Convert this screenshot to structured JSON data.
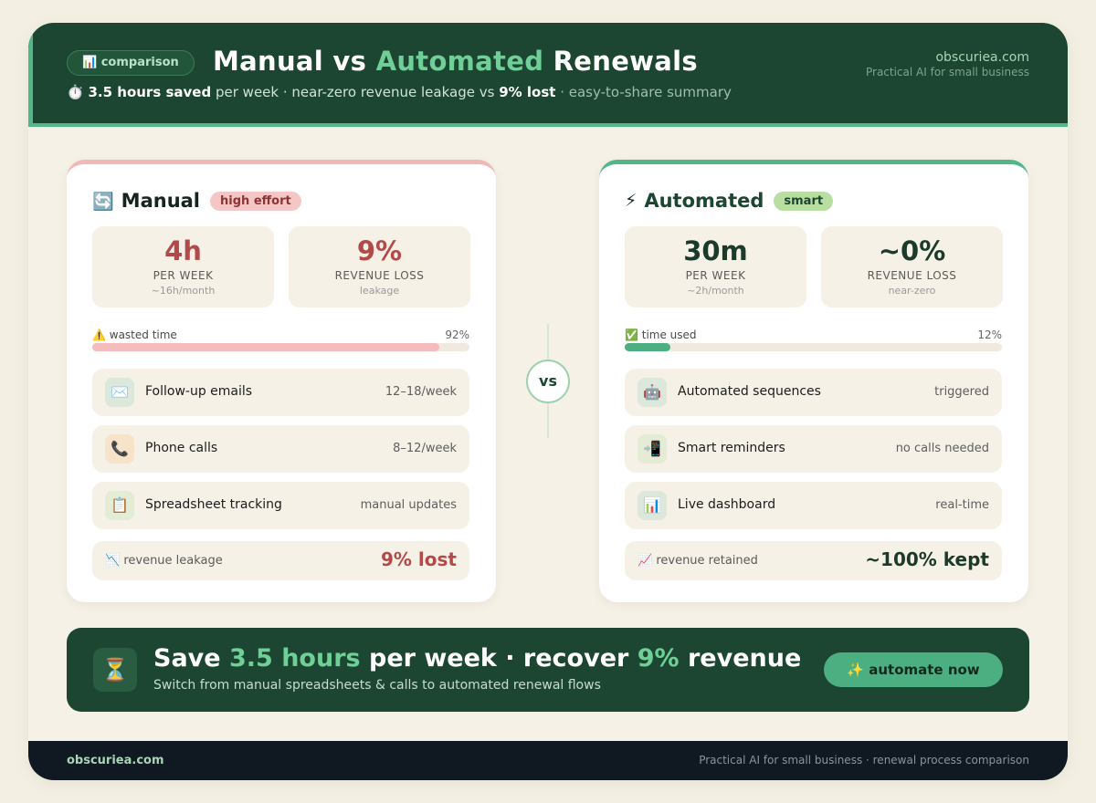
{
  "header": {
    "badge": "📊 comparison",
    "title_part1": "Manual vs ",
    "title_accent": "Automated",
    "title_part2": " Renewals",
    "sub_icon": "⏱️",
    "sub_bold1": "3.5 hours saved",
    "sub_text1": " per week · near-zero revenue leakage vs ",
    "sub_bold2": "9% lost",
    "sub_muted": "  ·  easy-to-share summary",
    "brand_domain": "obscuriea.com",
    "brand_tagline": "Practical AI for small business"
  },
  "manual": {
    "icon": "🔄",
    "name": "Manual",
    "tag": "high effort",
    "stats": [
      {
        "value": "4h",
        "label": "PER WEEK",
        "sub": "~16h/month"
      },
      {
        "value": "9%",
        "label": "REVENUE LOSS",
        "sub": "leakage"
      }
    ],
    "bar_label": "⚠️ wasted time",
    "bar_pct_text": "92%",
    "bar_fraction": 0.92,
    "rows": [
      {
        "icon": "✉️",
        "label": "Follow-up emails",
        "value": "12–18/week"
      },
      {
        "icon": "📞",
        "label": "Phone calls",
        "value": "8–12/week"
      },
      {
        "icon": "📋",
        "label": "Spreadsheet tracking",
        "value": "manual updates"
      }
    ],
    "result_label": "📉 revenue leakage",
    "result_value": "9% lost"
  },
  "vs": "vs",
  "automated": {
    "icon": "⚡",
    "name": "Automated",
    "tag": "smart",
    "stats": [
      {
        "value": "30m",
        "label": "PER WEEK",
        "sub": "~2h/month"
      },
      {
        "value": "~0%",
        "label": "REVENUE LOSS",
        "sub": "near-zero"
      }
    ],
    "bar_label": "✅ time used",
    "bar_pct_text": "12%",
    "bar_fraction": 0.12,
    "rows": [
      {
        "icon": "🤖",
        "label": "Automated sequences",
        "value": "triggered"
      },
      {
        "icon": "📲",
        "label": "Smart reminders",
        "value": "no calls needed"
      },
      {
        "icon": "📊",
        "label": "Live dashboard",
        "value": "real-time"
      }
    ],
    "result_label": "📈 revenue retained",
    "result_value": "~100% kept"
  },
  "cta": {
    "icon": "⏳",
    "p1": "Save ",
    "g1": "3.5 hours",
    "p2": " per week · recover ",
    "g2": "9%",
    "p3": " revenue",
    "subtitle": "Switch from manual spreadsheets & calls to automated renewal flows",
    "button": "✨ automate now"
  },
  "footer": {
    "left": "obscuriea.com",
    "right": "Practical AI for small business · renewal process comparison"
  },
  "colors": {
    "header_bg": "#1c4631",
    "accent_green": "#6fcf97",
    "manual_red": "#b34a4a",
    "bar_red": "#f4bcbc",
    "bar_green": "#4caf82"
  }
}
